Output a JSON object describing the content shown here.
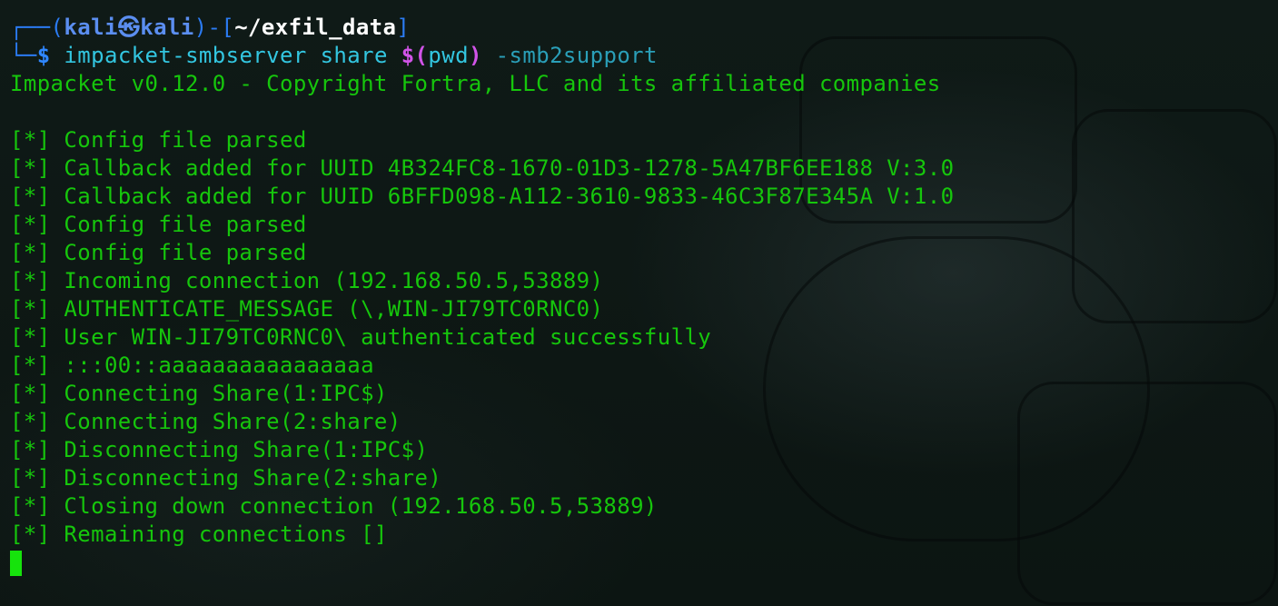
{
  "prompt": {
    "box_top_left": "┌──(",
    "user": "kali",
    "at_symbol": "㉿",
    "host": "kali",
    "bracket_mid": ")-[",
    "cwd": "~/exfil_data",
    "bracket_end": "]",
    "box_bottom_left": "└─",
    "dollar": "$"
  },
  "command": {
    "binary": "impacket-smbserver",
    "arg_share": "share",
    "sub_open": "$(",
    "sub_cmd": "pwd",
    "sub_close": ")",
    "flag": "-smb2support"
  },
  "output": {
    "banner": "Impacket v0.12.0 - Copyright Fortra, LLC and its affiliated companies",
    "blank": "",
    "lines": [
      "[*] Config file parsed",
      "[*] Callback added for UUID 4B324FC8-1670-01D3-1278-5A47BF6EE188 V:3.0",
      "[*] Callback added for UUID 6BFFD098-A112-3610-9833-46C3F87E345A V:1.0",
      "[*] Config file parsed",
      "[*] Config file parsed",
      "[*] Incoming connection (192.168.50.5,53889)",
      "[*] AUTHENTICATE_MESSAGE (\\,WIN-JI79TC0RNC0)",
      "[*] User WIN-JI79TC0RNC0\\ authenticated successfully",
      "[*] :::00::aaaaaaaaaaaaaaaa",
      "[*] Connecting Share(1:IPC$)",
      "[*] Connecting Share(2:share)",
      "[*] Disconnecting Share(1:IPC$)",
      "[*] Disconnecting Share(2:share)",
      "[*] Closing down connection (192.168.50.5,53889)",
      "[*] Remaining connections []"
    ]
  },
  "colors": {
    "background": "#0d1714",
    "output_green": "#16c60c",
    "prompt_blue": "#2f87ff",
    "cwd_white": "#ffffff",
    "command_cyan": "#33c6e0",
    "subshell_magenta": "#d154e8",
    "cursor_green": "#16e30c"
  },
  "icons": {
    "cursor": "block-cursor-icon"
  }
}
